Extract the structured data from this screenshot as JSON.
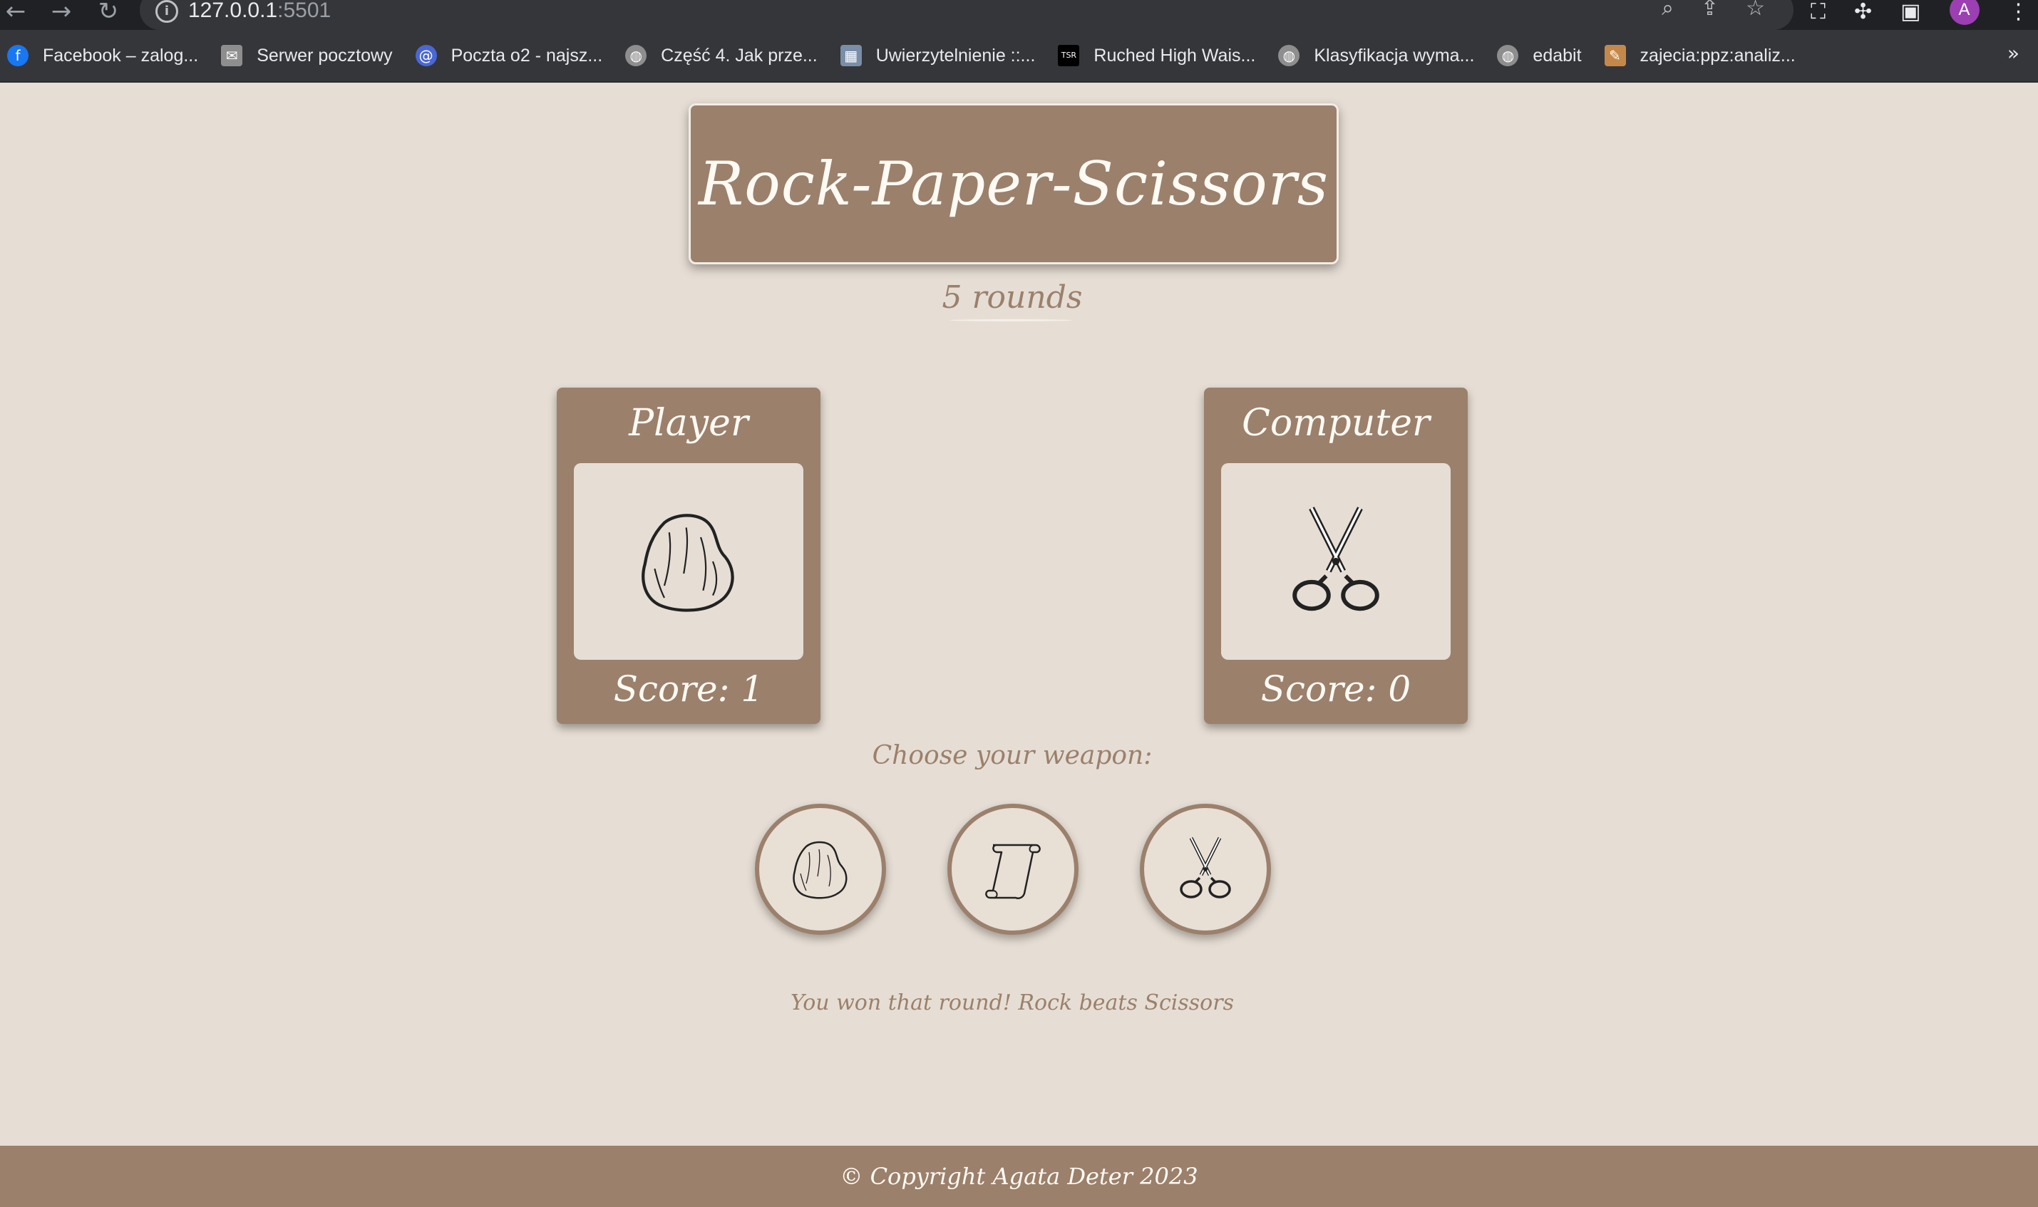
{
  "browser": {
    "url_host": "127.0.0.1",
    "url_port": ":5501",
    "avatar_letter": "A",
    "bookmarks": [
      {
        "label": "Facebook – zalog...",
        "color": "#1877f2"
      },
      {
        "label": "Serwer pocztowy",
        "color": "#8e8e8e"
      },
      {
        "label": "Poczta o2 - najsz...",
        "color": "#4a67d6"
      },
      {
        "label": "Część 4. Jak prze...",
        "color": "#8e8e8e"
      },
      {
        "label": "Uwierzytelnienie ::...",
        "color": "#7a8ea8"
      },
      {
        "label": "Ruched High Wais...",
        "color": "#000000"
      },
      {
        "label": "Klasyfikacja wyma...",
        "color": "#8e8e8e"
      },
      {
        "label": "edabit",
        "color": "#8e8e8e"
      },
      {
        "label": "zajecia:ppz:analiz...",
        "color": "#c4894a"
      }
    ],
    "more": "»"
  },
  "page": {
    "title": "Rock-Paper-Scissors",
    "rounds": "5 rounds",
    "player": {
      "name": "Player",
      "score_text": "Score: 1",
      "choice_icon": "rock-icon"
    },
    "computer": {
      "name": "Computer",
      "score_text": "Score:  0",
      "choice_icon": "scissors-icon"
    },
    "choose_label": "Choose your weapon:",
    "weapons": [
      {
        "name": "rock",
        "icon": "rock-icon"
      },
      {
        "name": "paper",
        "icon": "paper-scroll-icon"
      },
      {
        "name": "scissors",
        "icon": "scissors-icon"
      }
    ],
    "result_message": "You won that round! Rock beats Scissors",
    "footer": "© Copyright Agata Deter 2023"
  },
  "colors": {
    "background": "#e6ded4",
    "accent": "#9b806c",
    "text_light": "#fffaf3"
  }
}
